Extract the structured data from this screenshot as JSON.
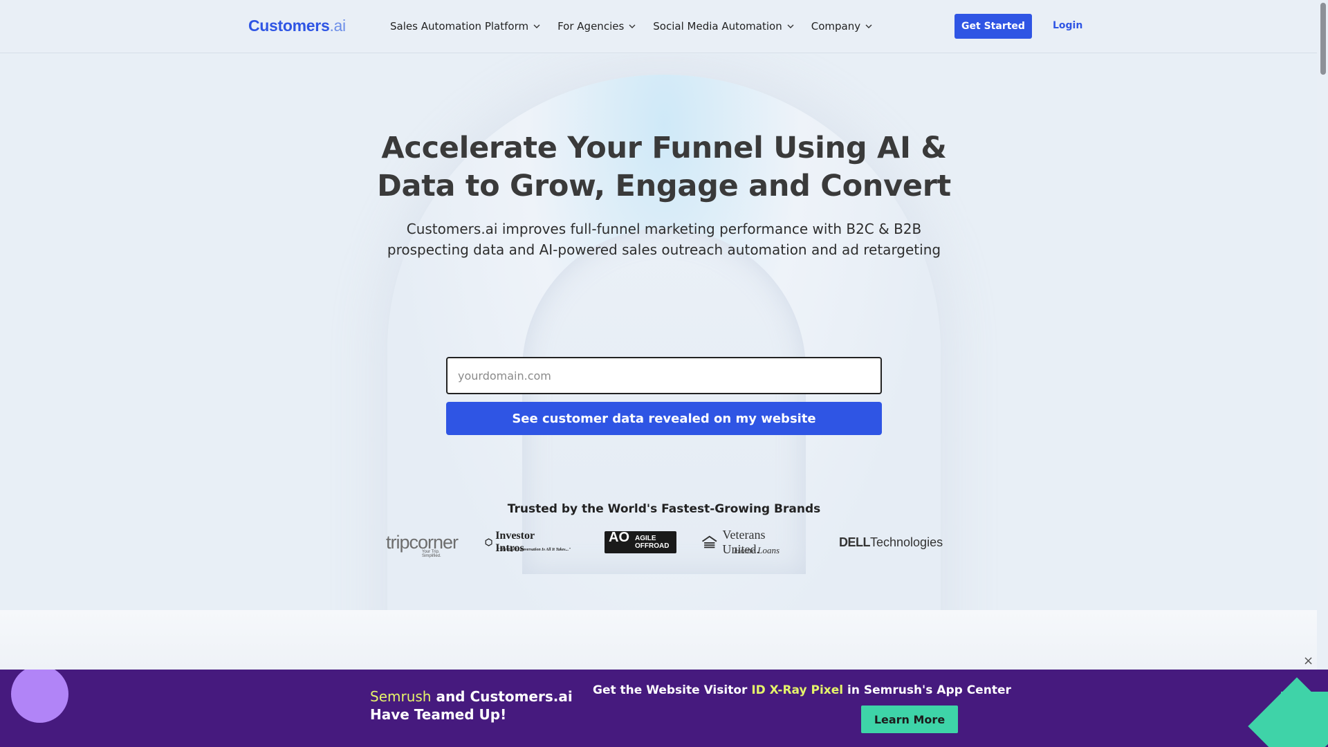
{
  "header": {
    "logo_main": "Customers",
    "logo_suffix": ".ai",
    "nav": [
      {
        "label": "Sales Automation Platform"
      },
      {
        "label": "For Agencies"
      },
      {
        "label": "Social Media Automation"
      },
      {
        "label": "Company"
      }
    ],
    "get_started": "Get Started",
    "login": "Login"
  },
  "hero": {
    "title_line1": "Accelerate Your Funnel Using AI &",
    "title_line2": "Data to Grow, Engage and Convert",
    "sub_line1": "Customers.ai improves full-funnel marketing performance with B2C & B2B",
    "sub_line2": "prospecting data and AI-powered sales outreach automation and ad retargeting",
    "input_placeholder": "yourdomain.com",
    "input_value": "",
    "cta": "See customer data revealed on my website",
    "trusted": "Trusted by the World's Fastest-Growing Brands"
  },
  "brands": {
    "tripcorner": "tripcorner",
    "tripcorner_tag": "Your Trip. Simplified.",
    "investor": "Investor Intros",
    "investor_tag": "\"The Right Conversation Is All It Takes...\"",
    "agile_1": "AGILE",
    "agile_2": "OFFROAD",
    "agile_mark": "AO",
    "veterans": "Veterans United.",
    "veterans_sub": "Home Loans",
    "dell_bold": "DELL",
    "dell_rest": "Technologies"
  },
  "promo": {
    "semrush": "Semrush",
    "left_rest": " and Customers.ai",
    "left_line2": "Have Teamed Up!",
    "right_pre": "Get the Website Visitor ",
    "right_hl": "ID X-Ray Pixel",
    "right_post": " in Semrush's App Center",
    "learn_more": "Learn More",
    "close": "×"
  },
  "icons": {
    "nav_chevron": "chevron-down-icon",
    "close": "close-icon"
  },
  "colors": {
    "brand_blue": "#2f55e4",
    "promo_purple": "#461a7e",
    "promo_highlight": "#e5f46a",
    "learn_green": "#3ed4a8",
    "circle_lilac": "#b184f7"
  }
}
